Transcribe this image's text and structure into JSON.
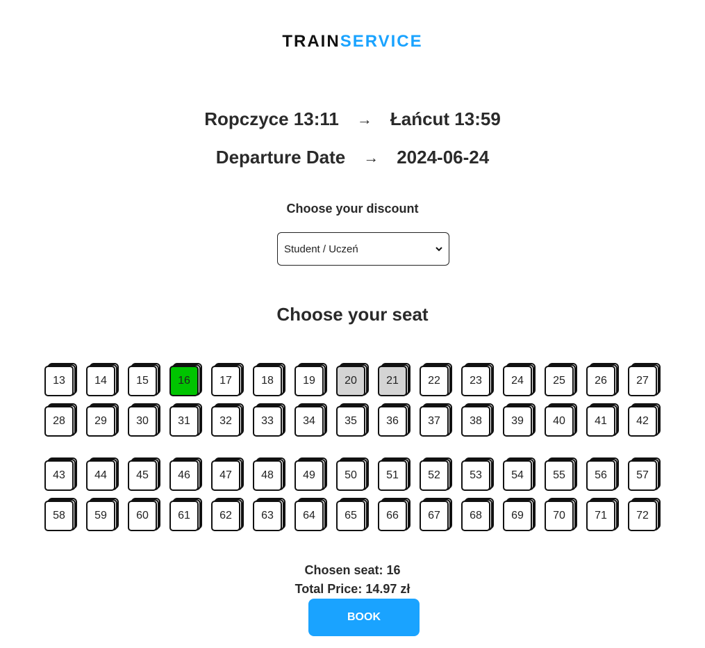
{
  "logo": {
    "part1": "TRAIN",
    "part2": "SERVICE"
  },
  "route": {
    "from": "Ropczyce 13:11",
    "to": "Łańcut 13:59",
    "date_label": "Departure Date",
    "date": "2024-06-24",
    "arrow": "→"
  },
  "discount": {
    "label": "Choose your discount",
    "selected": "Student / Uczeń"
  },
  "seats": {
    "title": "Choose your seat",
    "rows": [
      [
        "13",
        "14",
        "15",
        "16",
        "17",
        "18",
        "19",
        "20",
        "21",
        "22",
        "23",
        "24",
        "25",
        "26",
        "27"
      ],
      [
        "28",
        "29",
        "30",
        "31",
        "32",
        "33",
        "34",
        "35",
        "36",
        "37",
        "38",
        "39",
        "40",
        "41",
        "42"
      ],
      [
        "43",
        "44",
        "45",
        "46",
        "47",
        "48",
        "49",
        "50",
        "51",
        "52",
        "53",
        "54",
        "55",
        "56",
        "57"
      ],
      [
        "58",
        "59",
        "60",
        "61",
        "62",
        "63",
        "64",
        "65",
        "66",
        "67",
        "68",
        "69",
        "70",
        "71",
        "72"
      ]
    ],
    "taken": [
      "20",
      "21"
    ],
    "chosen": "16"
  },
  "summary": {
    "chosen_seat": "Chosen seat: 16",
    "total_price": "Total Price: 14.97 zł"
  },
  "book_label": "BOOK",
  "colors": {
    "accent": "#1aa3ff",
    "chosen": "#00c400",
    "taken": "#d4d4d4"
  }
}
